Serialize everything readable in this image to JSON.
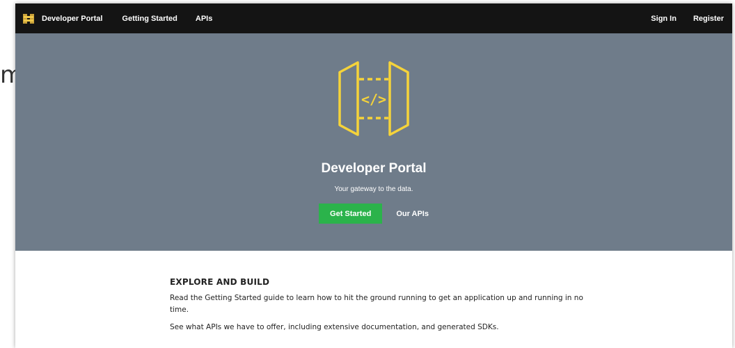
{
  "backdrop": {
    "fragment": "m"
  },
  "navbar": {
    "brand": "Developer Portal",
    "links": [
      "Getting Started",
      "APIs"
    ],
    "right_links": [
      "Sign In",
      "Register"
    ]
  },
  "hero": {
    "title": "Developer Portal",
    "subtitle": "Your gateway to the data.",
    "primary_button": "Get Started",
    "secondary_link": "Our APIs",
    "accent_color": "#f5d33a",
    "background_color": "#6f7c8a"
  },
  "content": {
    "heading": "EXPLORE AND BUILD",
    "paragraphs": [
      "Read the Getting Started guide to learn how to hit the ground running to get an application up and running in no time.",
      "See what APIs we have to offer, including extensive documentation, and generated SDKs."
    ]
  },
  "colors": {
    "navbar": "#141414",
    "button": "#2bb34b"
  }
}
